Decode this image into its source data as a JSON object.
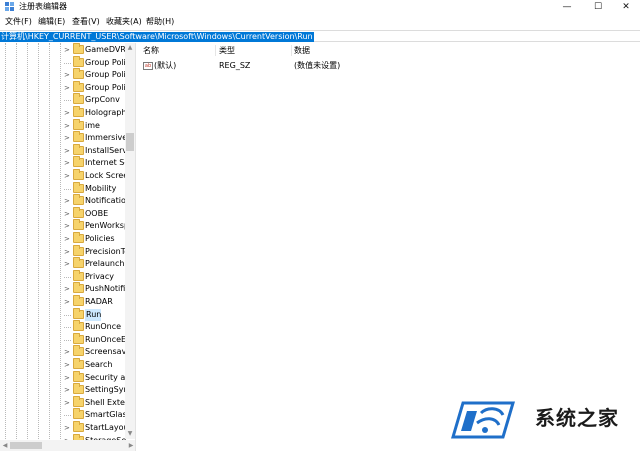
{
  "window": {
    "title": "注册表编辑器",
    "app_icon": "regedit-icon",
    "controls": {
      "minimize": "—",
      "maximize": "☐",
      "close": "✕"
    }
  },
  "menu": [
    "文件(F)",
    "编辑(E)",
    "查看(V)",
    "收藏夹(A)",
    "帮助(H)"
  ],
  "address": "计算机\\HKEY_CURRENT_USER\\Software\\Microsoft\\Windows\\CurrentVersion\\Run",
  "tree": {
    "items": [
      {
        "label": "GameDVR",
        "expander": ">"
      },
      {
        "label": "Group Poli",
        "expander": ""
      },
      {
        "label": "Group Poli",
        "expander": ">"
      },
      {
        "label": "Group Poli",
        "expander": ">"
      },
      {
        "label": "GrpConv",
        "expander": ""
      },
      {
        "label": "Holograph",
        "expander": ">"
      },
      {
        "label": "ime",
        "expander": ">"
      },
      {
        "label": "Immersive",
        "expander": ">"
      },
      {
        "label": "InstallServi",
        "expander": ">"
      },
      {
        "label": "Internet Se",
        "expander": ">"
      },
      {
        "label": "Lock Scree",
        "expander": ">"
      },
      {
        "label": "Mobility",
        "expander": ""
      },
      {
        "label": "Notification",
        "expander": ">"
      },
      {
        "label": "OOBE",
        "expander": ">"
      },
      {
        "label": "PenWorksp",
        "expander": ">"
      },
      {
        "label": "Policies",
        "expander": ">"
      },
      {
        "label": "PrecisionTo",
        "expander": ">"
      },
      {
        "label": "Prelaunch",
        "expander": ">"
      },
      {
        "label": "Privacy",
        "expander": ""
      },
      {
        "label": "PushNotific",
        "expander": ">"
      },
      {
        "label": "RADAR",
        "expander": ">"
      },
      {
        "label": "Run",
        "expander": "",
        "selected": true
      },
      {
        "label": "RunOnce",
        "expander": ""
      },
      {
        "label": "RunOnceEx",
        "expander": ""
      },
      {
        "label": "Screensave",
        "expander": ">"
      },
      {
        "label": "Search",
        "expander": ">"
      },
      {
        "label": "Security an",
        "expander": ">"
      },
      {
        "label": "SettingSync",
        "expander": ">"
      },
      {
        "label": "Shell Exten",
        "expander": ">"
      },
      {
        "label": "SmartGlass",
        "expander": ""
      },
      {
        "label": "StartLayout",
        "expander": ">"
      },
      {
        "label": "StorageSe",
        "expander": ">"
      }
    ]
  },
  "values_pane": {
    "columns": [
      "名称",
      "类型",
      "数据"
    ],
    "rows": [
      {
        "icon": "ab-string-icon",
        "icon_text": "ab",
        "name": "(默认)",
        "type": "REG_SZ",
        "data": "(数值未设置)"
      }
    ]
  },
  "watermark": {
    "text": "系统之家"
  },
  "colors": {
    "selection": "#0078d7",
    "tree_selected": "#cce8ff",
    "folder": "#f6d36b"
  }
}
